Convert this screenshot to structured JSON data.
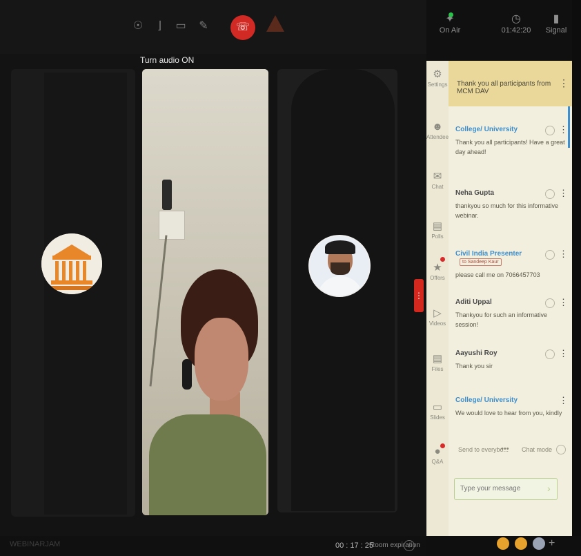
{
  "toolbar": {
    "tooltip": "Turn audio ON",
    "icons": [
      "webcam-icon",
      "microphone-icon",
      "screen-share-icon",
      "pen-icon",
      "end-call-icon",
      "warning-icon"
    ]
  },
  "sidebar_header": {
    "status_label": "On Air",
    "time": "01:42:20",
    "signal_label": "Signal"
  },
  "rail": {
    "items": [
      {
        "label": "Settings",
        "icon": "gear-icon"
      },
      {
        "label": "Attendees",
        "icon": "people-icon"
      },
      {
        "label": "Chat",
        "icon": "chat-icon"
      },
      {
        "label": "Polls",
        "icon": "poll-icon"
      },
      {
        "label": "Offers",
        "icon": "offer-icon"
      },
      {
        "label": "Videos",
        "icon": "video-icon"
      },
      {
        "label": "Files",
        "icon": "file-icon"
      },
      {
        "label": "Slides",
        "icon": "slides-icon"
      },
      {
        "label": "Q&A",
        "icon": "qa-icon"
      }
    ]
  },
  "chat": {
    "pinned": "Thank you all participants from MCM DAV",
    "messages": [
      {
        "name": "College/ University",
        "text": "Thank you all participants! Have a great day ahead!"
      },
      {
        "name": "Neha Gupta",
        "text": "thankyou so much for this informative webinar."
      },
      {
        "name": "Civil India Presenter",
        "to": "to Sandeep Kaur",
        "text": "please call me on 7066457703"
      },
      {
        "name": "Aditi Uppal",
        "text": "Thankyou for such an informative session!"
      },
      {
        "name": "Aayushi Roy",
        "text": "Thank you sir"
      },
      {
        "name": "College/ University",
        "text": "We would love to hear from you, kindly"
      }
    ],
    "send_to": "Send to everybo...",
    "send_more": "•••",
    "chat_mode": "Chat mode",
    "input_placeholder": "Type your message"
  },
  "footer": {
    "brand": "WEBINARJAM",
    "timer": "00 : 17 : 25",
    "room": "Room expiration"
  },
  "colors": {
    "end_call": "#d12a24",
    "chat_bg": "#f2efdf",
    "pinned_bg": "#e9d89a",
    "name_blue": "#3d8ecb",
    "accent_red": "#d4281f"
  }
}
